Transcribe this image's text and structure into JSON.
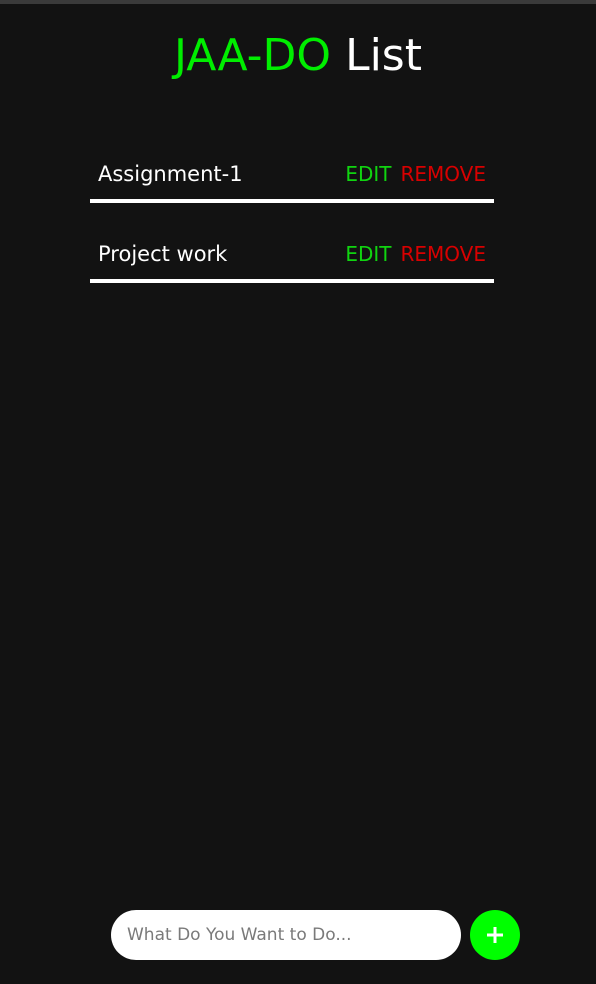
{
  "header": {
    "title_brand": "JAA-DO",
    "title_rest": "List"
  },
  "todos": [
    {
      "text": "Assignment-1",
      "edit_label": "EDIT",
      "remove_label": "REMOVE"
    },
    {
      "text": "Project work",
      "edit_label": "EDIT",
      "remove_label": "REMOVE"
    }
  ],
  "add_bar": {
    "placeholder": "What Do You Want to Do...",
    "value": "",
    "add_icon": "plus-icon"
  },
  "colors": {
    "background": "#121212",
    "brand_green": "#00ee00",
    "edit_green": "#10d410",
    "remove_red": "#d80000",
    "add_button": "#00ff00"
  }
}
